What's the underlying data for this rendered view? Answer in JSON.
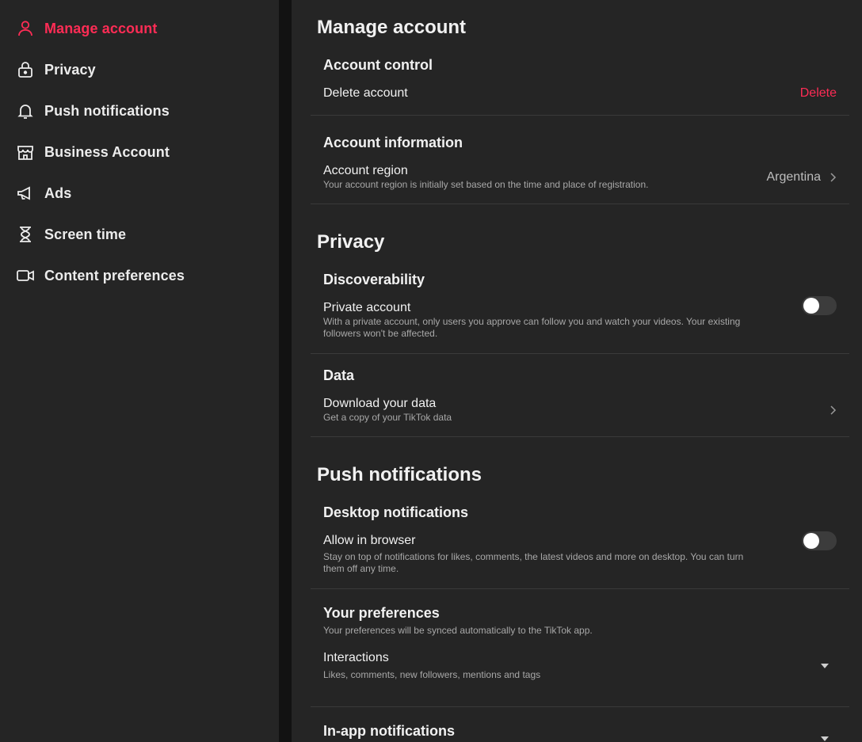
{
  "sidebar": {
    "items": [
      {
        "label": "Manage account",
        "icon": "person-icon",
        "active": true
      },
      {
        "label": "Privacy",
        "icon": "lock-icon"
      },
      {
        "label": "Push notifications",
        "icon": "bell-icon"
      },
      {
        "label": "Business Account",
        "icon": "store-icon"
      },
      {
        "label": "Ads",
        "icon": "megaphone-icon"
      },
      {
        "label": "Screen time",
        "icon": "hourglass-icon"
      },
      {
        "label": "Content preferences",
        "icon": "video-camera-icon"
      }
    ]
  },
  "colors": {
    "accent": "#fe2c55",
    "background": "#252525",
    "divider": "#121212"
  },
  "manage_account": {
    "title": "Manage account",
    "account_control": {
      "title": "Account control",
      "delete_label": "Delete account",
      "delete_action": "Delete"
    },
    "account_information": {
      "title": "Account information",
      "region_label": "Account region",
      "region_desc": "Your account region is initially set based on the time and place of registration.",
      "region_value": "Argentina"
    }
  },
  "privacy": {
    "title": "Privacy",
    "discoverability": {
      "title": "Discoverability",
      "private_label": "Private account",
      "private_desc": "With a private account, only users you approve can follow you and watch your videos. Your existing followers won't be affected.",
      "private_on": false
    },
    "data": {
      "title": "Data",
      "download_label": "Download your data",
      "download_desc": "Get a copy of your TikTok data"
    }
  },
  "push_notifications": {
    "title": "Push notifications",
    "desktop": {
      "title": "Desktop notifications",
      "allow_label": "Allow in browser",
      "allow_desc": "Stay on top of notifications for likes, comments, the latest videos and more on desktop. You can turn them off any time.",
      "allow_on": false
    },
    "preferences": {
      "title": "Your preferences",
      "desc": "Your preferences will be synced automatically to the TikTok app.",
      "interactions_label": "Interactions",
      "interactions_desc": "Likes, comments, new followers, mentions and tags"
    },
    "in_app": {
      "title": "In-app notifications"
    }
  }
}
